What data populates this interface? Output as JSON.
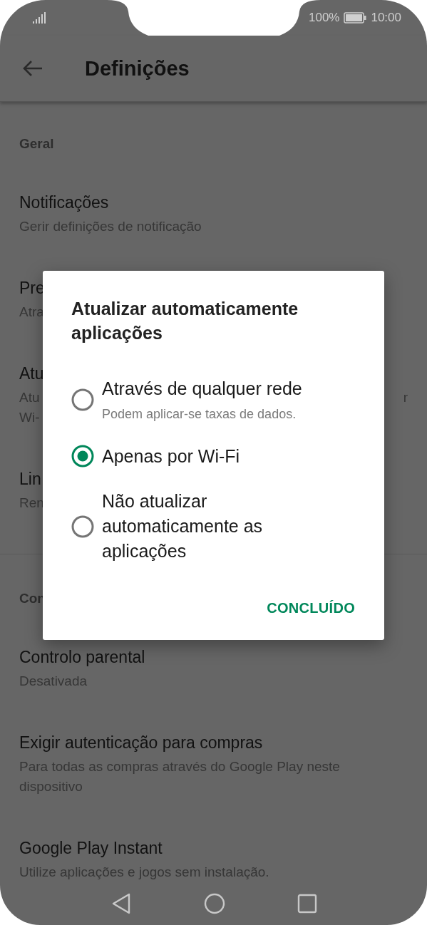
{
  "status_bar": {
    "battery": "100%",
    "time": "10:00"
  },
  "app_bar": {
    "title": "Definições"
  },
  "settings": [
    {
      "kind": "header",
      "title": "Geral"
    },
    {
      "kind": "item",
      "title": "Notificações",
      "subtitle": [
        "Gerir definições de notificação"
      ]
    },
    {
      "kind": "item",
      "title": "Pre",
      "subtitle": [
        "Atra"
      ]
    },
    {
      "kind": "item",
      "title": "Atu",
      "subtitle": [
        "Atu",
        "Wi-"
      ],
      "subtitle_right": "r"
    },
    {
      "kind": "item",
      "title": "Lin",
      "subtitle": [
        "Ren"
      ]
    },
    {
      "kind": "divider"
    },
    {
      "kind": "header",
      "title": "Con"
    },
    {
      "kind": "item",
      "title": "Controlo parental",
      "subtitle": [
        "Desativada"
      ]
    },
    {
      "kind": "item",
      "title": "Exigir autenticação para compras",
      "subtitle": [
        "Para todas as compras através do Google Play neste",
        "dispositivo"
      ]
    },
    {
      "kind": "item",
      "title": "Google Play Instant",
      "subtitle": [
        "Utilize aplicações e jogos sem instalação."
      ]
    }
  ],
  "dialog": {
    "title": "Atualizar automaticamente aplicações",
    "options": [
      {
        "label": "Através de qualquer rede",
        "description": "Podem aplicar-se taxas de dados.",
        "selected": false
      },
      {
        "label": "Apenas por Wi-Fi",
        "selected": true
      },
      {
        "label": "Não atualizar automaticamente as aplicações",
        "selected": false
      }
    ],
    "button": "CONCLUÍDO"
  }
}
